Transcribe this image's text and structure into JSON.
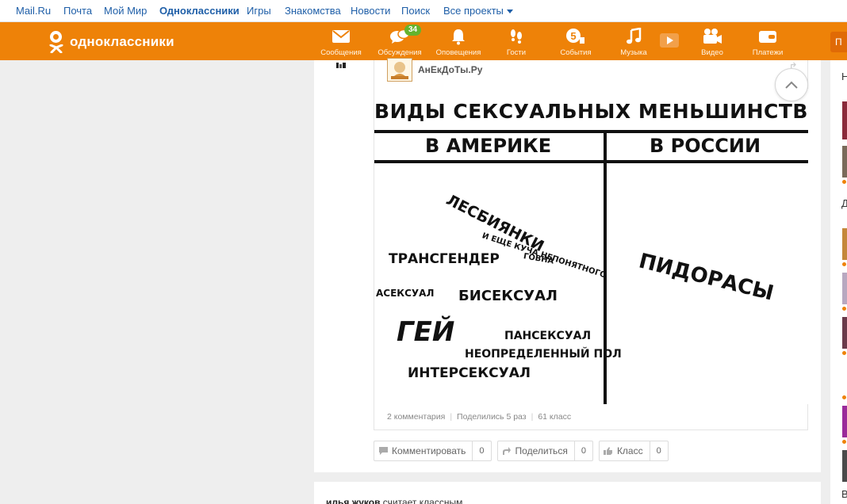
{
  "topnav": {
    "links": [
      "Mail.Ru",
      "Почта",
      "Мой Мир",
      "Одноклассники",
      "Игры",
      "Знакомства",
      "Новости",
      "Поиск",
      "Все проекты"
    ]
  },
  "header": {
    "logo_text": "одноклассники",
    "nav": [
      {
        "label": "Сообщения",
        "icon": "envelope-icon"
      },
      {
        "label": "Обсуждения",
        "icon": "chat-bubbles-icon",
        "badge": "34"
      },
      {
        "label": "Оповещения",
        "icon": "bell-icon"
      },
      {
        "label": "Гости",
        "icon": "footprints-icon"
      },
      {
        "label": "События",
        "icon": "five-plus-icon"
      },
      {
        "label": "Музыка",
        "icon": "music-note-icon"
      },
      {
        "label": "Видео",
        "icon": "camera-icon"
      },
      {
        "label": "Платежи",
        "icon": "wallet-icon"
      }
    ],
    "right_button": "П"
  },
  "post": {
    "group_name": "АнЕкДоТы.Ру",
    "meme": {
      "title": "ВИДЫ СЕКСУАЛЬНЫХ МЕНЬШИНСТВ",
      "col_left": "В АМЕРИКЕ",
      "col_right": "В РОССИИ",
      "words": {
        "lesbians": "ЛЕСБИЯНКИ",
        "and_more": "И ЕЩЕ КУЧА НЕПОНЯТНОГО",
        "shit": "ГОВНА",
        "transgender": "ТРАНСГЕНДЕР",
        "asexual": "АСЕКСУАЛ",
        "bisexual": "БИСЕКСУАЛ",
        "gay": "ГЕЙ",
        "pansexual": "ПАНСЕКСУАЛ",
        "undefined": "НЕОПРЕДЕЛЕННЫЙ ПОЛ",
        "intersexual": "ИНТЕРСЕКСУАЛ",
        "russia_word": "ПИДОРАСЫ"
      }
    },
    "stats": {
      "comments": "2 комментария",
      "shares": "Поделились 5 раз",
      "likes": "61 класс"
    },
    "actions": {
      "comment": {
        "label": "Комментировать",
        "count": "0"
      },
      "share": {
        "label": "Поделиться",
        "count": "0"
      },
      "like": {
        "label": "Класс",
        "count": "0"
      }
    }
  },
  "next_post": {
    "author": "илья жуков",
    "action_text": "считает классным"
  },
  "right_column": {
    "letters": [
      "Н",
      "Д",
      "В"
    ]
  },
  "colors": {
    "brand_orange": "#ee8208",
    "link_blue": "#1f5fa8",
    "badge_green": "#65b32e"
  }
}
